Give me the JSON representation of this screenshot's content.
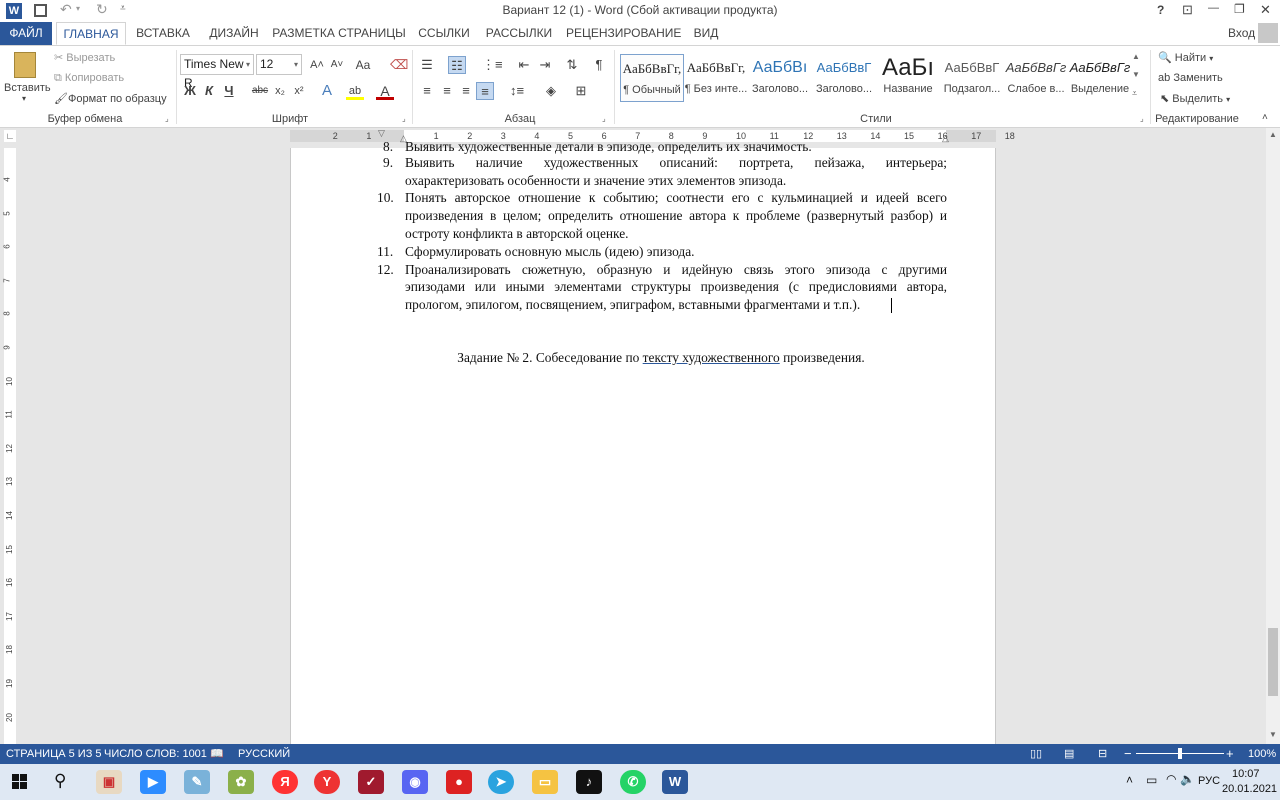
{
  "title": "Вариант 12 (1) - Word (Сбой активации продукта)",
  "window_buttons": {
    "help": "?",
    "ribbon_opts": "⊡",
    "minimize": "—",
    "restore": "❐",
    "close": "✕"
  },
  "signin": "Вход",
  "tabs": [
    "ФАЙЛ",
    "ГЛАВНАЯ",
    "ВСТАВКА",
    "ДИЗАЙН",
    "РАЗМЕТКА СТРАНИЦЫ",
    "ССЫЛКИ",
    "РАССЫЛКИ",
    "РЕЦЕНЗИРОВАНИЕ",
    "ВИД"
  ],
  "clipboard": {
    "paste": "Вставить",
    "cut": "Вырезать",
    "copy": "Копировать",
    "format_painter": "Формат по образцу",
    "label": "Буфер обмена"
  },
  "font": {
    "name": "Times New R",
    "size": "12",
    "label": "Шрифт",
    "bold": "Ж",
    "italic": "К",
    "underline": "Ч",
    "strike": "abc",
    "sub": "x₂",
    "sup": "x²",
    "grow": "A˄",
    "shrink": "A˅",
    "case": "Aa",
    "effects": "A",
    "highlight": "ab",
    "color": "A"
  },
  "paragraph": {
    "label": "Абзац"
  },
  "styles": {
    "label": "Стили",
    "items": [
      {
        "preview": "АаБбВвГг,",
        "name": "¶ Обычный"
      },
      {
        "preview": "АаБбВвГг,",
        "name": "¶ Без инте..."
      },
      {
        "preview": "АаБбВı",
        "name": "Заголово..."
      },
      {
        "preview": "АаБбВвГ",
        "name": "Заголово..."
      },
      {
        "preview": "АаБı",
        "name": "Название"
      },
      {
        "preview": "АаБбВвГ",
        "name": "Подзагол..."
      },
      {
        "preview": "АаБбВвГг",
        "name": "Слабое в..."
      },
      {
        "preview": "АаБбВвГг",
        "name": "Выделение"
      }
    ]
  },
  "editing": {
    "find": "Найти",
    "replace": "Заменить",
    "select": "Выделить",
    "label": "Редактирование"
  },
  "ruler_ticks": [
    "2",
    "1",
    "1",
    "2",
    "3",
    "4",
    "5",
    "6",
    "7",
    "8",
    "9",
    "10",
    "11",
    "12",
    "13",
    "14",
    "15",
    "16",
    "17",
    "18"
  ],
  "vruler_ticks": [
    "4",
    "5",
    "6",
    "7",
    "8",
    "9",
    "10",
    "11",
    "12",
    "13",
    "14",
    "15",
    "16",
    "17",
    "18",
    "19",
    "20"
  ],
  "document": {
    "partial_line": "Выявить художественные детали в эпизоде, определить их значимость.",
    "items": [
      {
        "num": "9.",
        "lines": [
          "Выявить наличие художественных описаний: портрета, пейзажа, интерьера;",
          "охарактеризовать особенности и значение этих элементов эпизода."
        ]
      },
      {
        "num": "10.",
        "lines": [
          "Понять авторское отношение к событию; соотнести его с кульминацией и идеей всего",
          "произведения в целом; определить отношение автора к проблеме (развернутый разбор) и",
          "остроту конфликта в авторской оценке."
        ]
      },
      {
        "num": "11.",
        "lines": [
          "Сформулировать основную мысль (идею) эпизода."
        ]
      },
      {
        "num": "12.",
        "lines": [
          "Проанализировать сюжетную, образную и идейную связь этого эпизода с другими",
          "эпизодами или иными элементами структуры произведения (с предисловиями автора,",
          "прологом, эпилогом, посвящением, эпиграфом, вставными фрагментами и т.п.)."
        ]
      }
    ],
    "task_before": "Задание № 2. Собеседование по ",
    "task_link": "тексту  художественного",
    "task_after": " произведения."
  },
  "status": {
    "page": "СТРАНИЦА 5 ИЗ 5",
    "words": "ЧИСЛО СЛОВ: 1001",
    "lang": "РУССКИЙ",
    "zoom": "100%",
    "zoom_level": 0.5
  },
  "tray": {
    "lang": "РУС",
    "time": "10:07",
    "date": "20.01.2021"
  },
  "colors": {
    "accent": "#2b579a",
    "taskbar": "#dfe8f3"
  }
}
